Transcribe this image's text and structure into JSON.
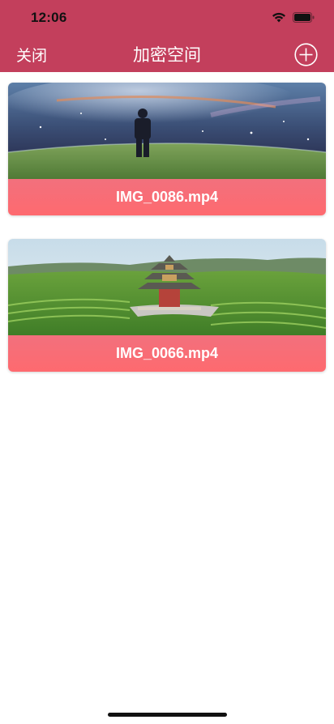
{
  "status_bar": {
    "time": "12:06",
    "icons": [
      "wifi-icon",
      "battery-icon"
    ]
  },
  "navbar": {
    "close_label": "关闭",
    "title": "加密空间",
    "add_icon": "plus-circle-icon"
  },
  "videos": [
    {
      "filename": "IMG_0086.mp4",
      "thumbnail": "man standing on grassy hill under starry night sky"
    },
    {
      "filename": "IMG_0066.mp4",
      "thumbnail": "pagoda among terraced tea fields and mountains"
    }
  ],
  "colors": {
    "header": "#c33f5c",
    "caption": "#fe6a6f"
  }
}
